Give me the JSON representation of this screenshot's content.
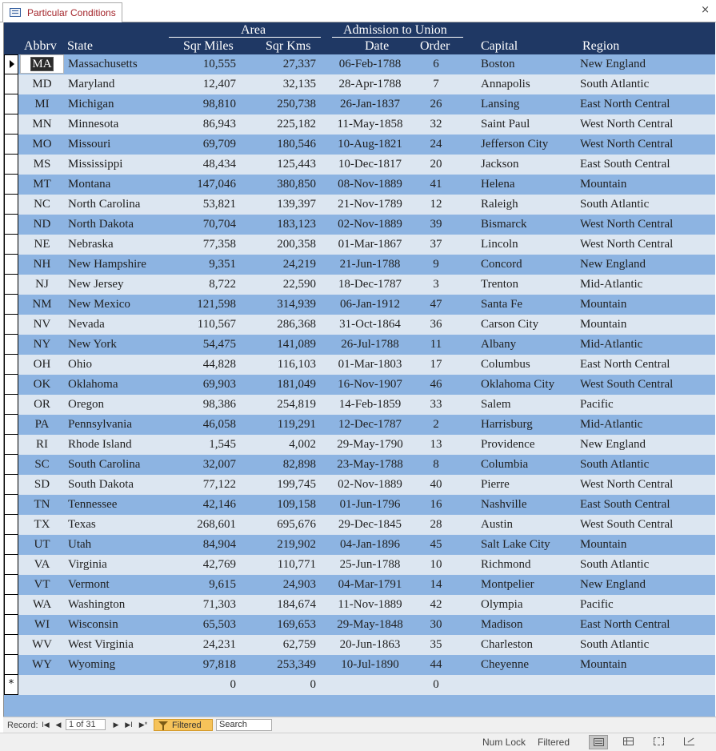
{
  "tab": {
    "title": "Particular Conditions",
    "close_glyph": "×"
  },
  "headers": {
    "area_group": "Area",
    "admission_group": "Admission to Union",
    "abbrv": "Abbrv",
    "state": "State",
    "sqr_miles": "Sqr Miles",
    "sqr_kms": "Sqr Kms",
    "date": "Date",
    "order": "Order",
    "capital": "Capital",
    "region": "Region"
  },
  "rows": [
    {
      "abbr": "MA",
      "state": "Massachusetts",
      "sqmi": "10,555",
      "sqkm": "27,337",
      "date": "06-Feb-1788",
      "order": "6",
      "capital": "Boston",
      "region": "New England"
    },
    {
      "abbr": "MD",
      "state": "Maryland",
      "sqmi": "12,407",
      "sqkm": "32,135",
      "date": "28-Apr-1788",
      "order": "7",
      "capital": "Annapolis",
      "region": "South Atlantic"
    },
    {
      "abbr": "MI",
      "state": "Michigan",
      "sqmi": "98,810",
      "sqkm": "250,738",
      "date": "26-Jan-1837",
      "order": "26",
      "capital": "Lansing",
      "region": "East North Central"
    },
    {
      "abbr": "MN",
      "state": "Minnesota",
      "sqmi": "86,943",
      "sqkm": "225,182",
      "date": "11-May-1858",
      "order": "32",
      "capital": "Saint Paul",
      "region": "West North Central"
    },
    {
      "abbr": "MO",
      "state": "Missouri",
      "sqmi": "69,709",
      "sqkm": "180,546",
      "date": "10-Aug-1821",
      "order": "24",
      "capital": "Jefferson City",
      "region": "West North Central"
    },
    {
      "abbr": "MS",
      "state": "Mississippi",
      "sqmi": "48,434",
      "sqkm": "125,443",
      "date": "10-Dec-1817",
      "order": "20",
      "capital": "Jackson",
      "region": "East South Central"
    },
    {
      "abbr": "MT",
      "state": "Montana",
      "sqmi": "147,046",
      "sqkm": "380,850",
      "date": "08-Nov-1889",
      "order": "41",
      "capital": "Helena",
      "region": "Mountain"
    },
    {
      "abbr": "NC",
      "state": "North Carolina",
      "sqmi": "53,821",
      "sqkm": "139,397",
      "date": "21-Nov-1789",
      "order": "12",
      "capital": "Raleigh",
      "region": "South Atlantic"
    },
    {
      "abbr": "ND",
      "state": "North Dakota",
      "sqmi": "70,704",
      "sqkm": "183,123",
      "date": "02-Nov-1889",
      "order": "39",
      "capital": "Bismarck",
      "region": "West North Central"
    },
    {
      "abbr": "NE",
      "state": "Nebraska",
      "sqmi": "77,358",
      "sqkm": "200,358",
      "date": "01-Mar-1867",
      "order": "37",
      "capital": "Lincoln",
      "region": "West North Central"
    },
    {
      "abbr": "NH",
      "state": "New Hampshire",
      "sqmi": "9,351",
      "sqkm": "24,219",
      "date": "21-Jun-1788",
      "order": "9",
      "capital": "Concord",
      "region": "New England"
    },
    {
      "abbr": "NJ",
      "state": "New Jersey",
      "sqmi": "8,722",
      "sqkm": "22,590",
      "date": "18-Dec-1787",
      "order": "3",
      "capital": "Trenton",
      "region": "Mid-Atlantic"
    },
    {
      "abbr": "NM",
      "state": "New Mexico",
      "sqmi": "121,598",
      "sqkm": "314,939",
      "date": "06-Jan-1912",
      "order": "47",
      "capital": "Santa Fe",
      "region": "Mountain"
    },
    {
      "abbr": "NV",
      "state": "Nevada",
      "sqmi": "110,567",
      "sqkm": "286,368",
      "date": "31-Oct-1864",
      "order": "36",
      "capital": "Carson City",
      "region": "Mountain"
    },
    {
      "abbr": "NY",
      "state": "New York",
      "sqmi": "54,475",
      "sqkm": "141,089",
      "date": "26-Jul-1788",
      "order": "11",
      "capital": "Albany",
      "region": "Mid-Atlantic"
    },
    {
      "abbr": "OH",
      "state": "Ohio",
      "sqmi": "44,828",
      "sqkm": "116,103",
      "date": "01-Mar-1803",
      "order": "17",
      "capital": "Columbus",
      "region": "East North Central"
    },
    {
      "abbr": "OK",
      "state": "Oklahoma",
      "sqmi": "69,903",
      "sqkm": "181,049",
      "date": "16-Nov-1907",
      "order": "46",
      "capital": "Oklahoma City",
      "region": "West South Central"
    },
    {
      "abbr": "OR",
      "state": "Oregon",
      "sqmi": "98,386",
      "sqkm": "254,819",
      "date": "14-Feb-1859",
      "order": "33",
      "capital": "Salem",
      "region": "Pacific"
    },
    {
      "abbr": "PA",
      "state": "Pennsylvania",
      "sqmi": "46,058",
      "sqkm": "119,291",
      "date": "12-Dec-1787",
      "order": "2",
      "capital": "Harrisburg",
      "region": "Mid-Atlantic"
    },
    {
      "abbr": "RI",
      "state": "Rhode Island",
      "sqmi": "1,545",
      "sqkm": "4,002",
      "date": "29-May-1790",
      "order": "13",
      "capital": "Providence",
      "region": "New England"
    },
    {
      "abbr": "SC",
      "state": "South Carolina",
      "sqmi": "32,007",
      "sqkm": "82,898",
      "date": "23-May-1788",
      "order": "8",
      "capital": "Columbia",
      "region": "South Atlantic"
    },
    {
      "abbr": "SD",
      "state": "South Dakota",
      "sqmi": "77,122",
      "sqkm": "199,745",
      "date": "02-Nov-1889",
      "order": "40",
      "capital": "Pierre",
      "region": "West North Central"
    },
    {
      "abbr": "TN",
      "state": "Tennessee",
      "sqmi": "42,146",
      "sqkm": "109,158",
      "date": "01-Jun-1796",
      "order": "16",
      "capital": "Nashville",
      "region": "East South Central"
    },
    {
      "abbr": "TX",
      "state": "Texas",
      "sqmi": "268,601",
      "sqkm": "695,676",
      "date": "29-Dec-1845",
      "order": "28",
      "capital": "Austin",
      "region": "West South Central"
    },
    {
      "abbr": "UT",
      "state": "Utah",
      "sqmi": "84,904",
      "sqkm": "219,902",
      "date": "04-Jan-1896",
      "order": "45",
      "capital": "Salt Lake City",
      "region": "Mountain"
    },
    {
      "abbr": "VA",
      "state": "Virginia",
      "sqmi": "42,769",
      "sqkm": "110,771",
      "date": "25-Jun-1788",
      "order": "10",
      "capital": "Richmond",
      "region": "South Atlantic"
    },
    {
      "abbr": "VT",
      "state": "Vermont",
      "sqmi": "9,615",
      "sqkm": "24,903",
      "date": "04-Mar-1791",
      "order": "14",
      "capital": "Montpelier",
      "region": "New England"
    },
    {
      "abbr": "WA",
      "state": "Washington",
      "sqmi": "71,303",
      "sqkm": "184,674",
      "date": "11-Nov-1889",
      "order": "42",
      "capital": "Olympia",
      "region": "Pacific"
    },
    {
      "abbr": "WI",
      "state": "Wisconsin",
      "sqmi": "65,503",
      "sqkm": "169,653",
      "date": "29-May-1848",
      "order": "30",
      "capital": "Madison",
      "region": "East North Central"
    },
    {
      "abbr": "WV",
      "state": "West Virginia",
      "sqmi": "24,231",
      "sqkm": "62,759",
      "date": "20-Jun-1863",
      "order": "35",
      "capital": "Charleston",
      "region": "South Atlantic"
    },
    {
      "abbr": "WY",
      "state": "Wyoming",
      "sqmi": "97,818",
      "sqkm": "253,349",
      "date": "10-Jul-1890",
      "order": "44",
      "capital": "Cheyenne",
      "region": "Mountain"
    }
  ],
  "new_record": {
    "marker": "*",
    "sqmi": "0",
    "sqkm": "0",
    "order": "0"
  },
  "navigation": {
    "label": "Record:",
    "first": "I◀",
    "prev": "◀",
    "current": "1 of 31",
    "next": "▶",
    "last": "▶I",
    "new": "▶*",
    "filter_label": "Filtered",
    "search_placeholder": "Search"
  },
  "status": {
    "num_lock": "Num Lock",
    "filtered": "Filtered"
  },
  "icons": {
    "form": "form-icon",
    "views": [
      "form-view-icon",
      "datasheet-view-icon",
      "layout-view-icon",
      "design-view-icon"
    ]
  },
  "colors": {
    "header_bg": "#1f3864",
    "row_band_a": "#8db4e2",
    "row_band_b": "#dce6f1",
    "tab_label": "#a4262c",
    "filter_badge": "#f6c35a"
  }
}
